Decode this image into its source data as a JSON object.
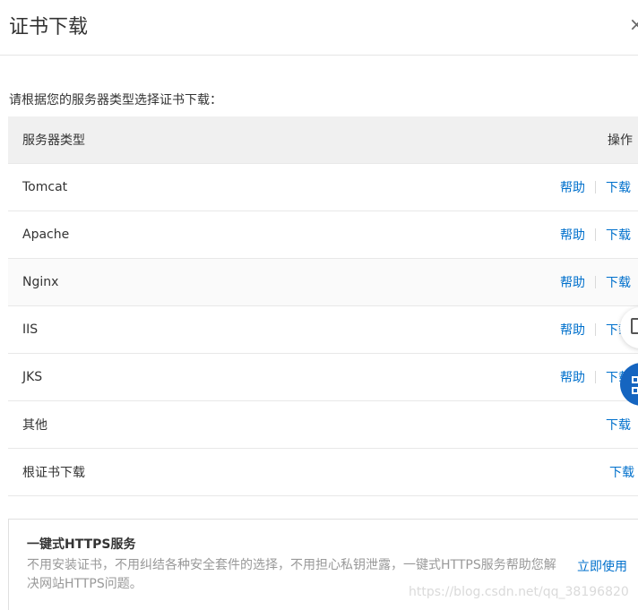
{
  "dialog": {
    "title": "证书下载",
    "close_glyph": "×"
  },
  "intro": "请根据您的服务器类型选择证书下载：",
  "table": {
    "headers": {
      "type": "服务器类型",
      "op": "操作"
    },
    "help_label": "帮助",
    "download_label": "下载",
    "rows": [
      {
        "type": "Tomcat"
      },
      {
        "type": "Apache"
      },
      {
        "type": "Nginx"
      },
      {
        "type": "IIS"
      },
      {
        "type": "JKS"
      },
      {
        "type": "其他"
      },
      {
        "type": "根证书下载"
      }
    ]
  },
  "promo": {
    "title": "一键式HTTPS服务",
    "description": "不用安装证书，不用纠结各种安全套件的选择，不用担心私钥泄露，一键式HTTPS服务帮助您解决网站HTTPS问题。",
    "action": "立即使用"
  },
  "watermark": "https://blog.csdn.net/qq_38196820",
  "colors": {
    "link": "#0070cc",
    "float_button": "#1565c0"
  },
  "icons": {
    "close": "close-icon",
    "feedback": "feedback-icon",
    "grid": "grid-icon"
  }
}
